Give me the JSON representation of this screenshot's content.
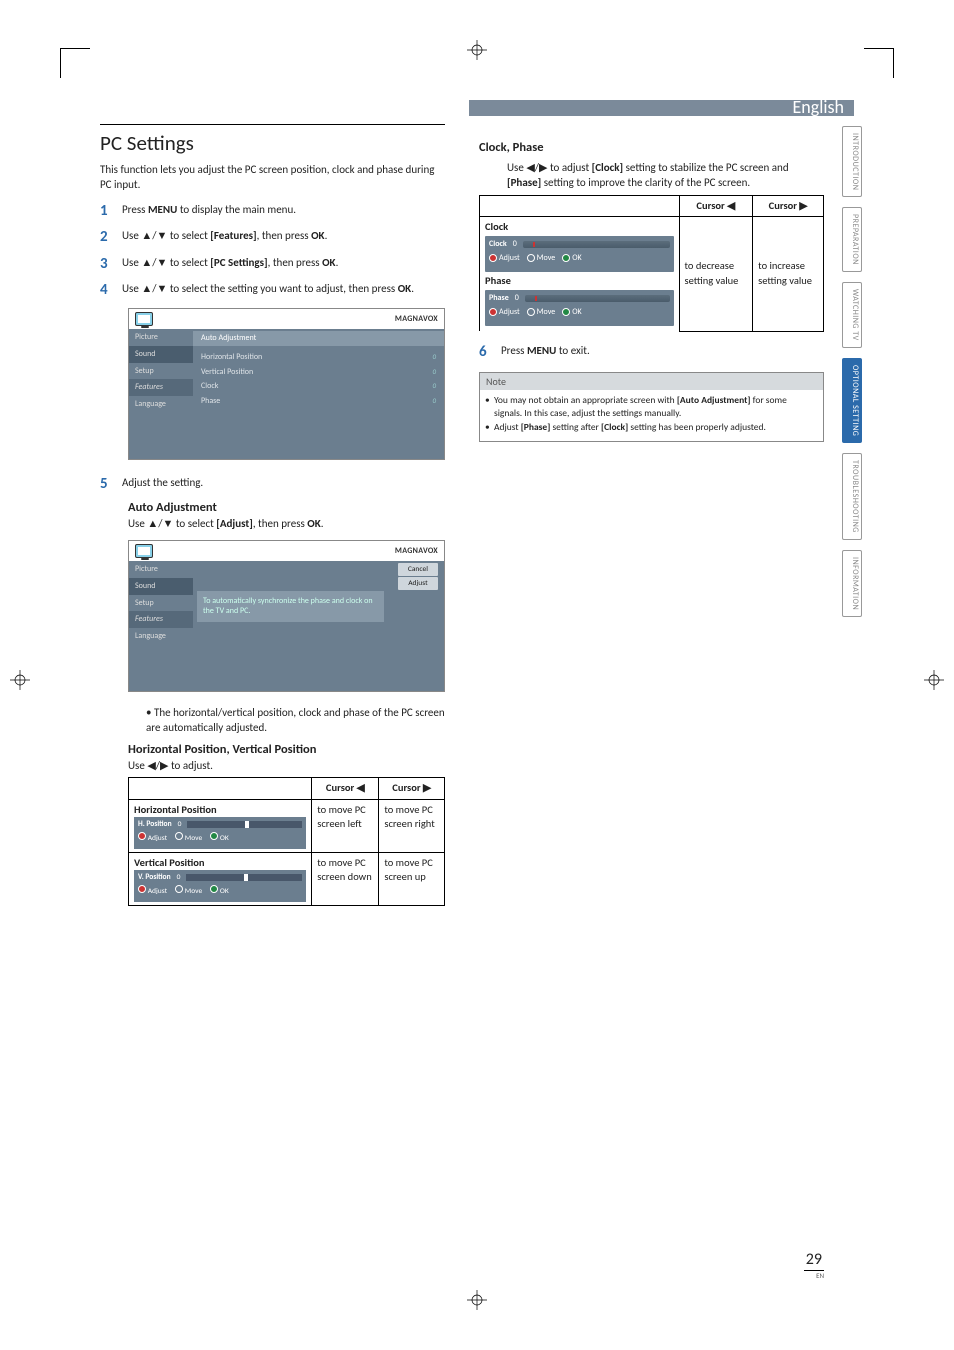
{
  "header": {
    "lang": "English"
  },
  "sidebar": [
    "INTRODUCTION",
    "PREPARATION",
    "WATCHING TV",
    "OPTIONAL SETTING",
    "TROUBLESHOOTING",
    "INFORMATION"
  ],
  "left": {
    "h1": "PC Settings",
    "intro": "This function lets you adjust the PC screen position, clock and phase during PC input.",
    "steps": [
      {
        "n": "1",
        "pre": "Press ",
        "b": "MENU",
        "post": " to display the main menu."
      },
      {
        "n": "2",
        "pre": "Use ▲/▼ to select ",
        "b": "[Features]",
        "mid": ", then press ",
        "b2": "OK",
        "post": "."
      },
      {
        "n": "3",
        "pre": "Use ▲/▼ to select ",
        "b": "[PC Settings]",
        "mid": ", then press ",
        "b2": "OK",
        "post": "."
      },
      {
        "n": "4",
        "pre": "Use ▲/▼ to select the setting you want to adjust, then press ",
        "b": "OK",
        "post": "."
      }
    ],
    "osd1": {
      "logo": "MAGNAVOX",
      "left": [
        "Picture",
        "Sound",
        "Setup",
        "Features",
        "Language"
      ],
      "rows": [
        {
          "l": "Auto Adjustment",
          "v": ""
        },
        {
          "l": "",
          "v": ""
        },
        {
          "l": "Horizontal Position",
          "v": "0"
        },
        {
          "l": "Vertical Position",
          "v": "0"
        },
        {
          "l": "Clock",
          "v": "0"
        },
        {
          "l": "Phase",
          "v": "0"
        }
      ]
    },
    "step5": {
      "n": "5",
      "t": "Adjust the setting."
    },
    "auto": {
      "h": "Auto Adjustment",
      "sub_pre": "Use ▲/▼ to select ",
      "sub_b": "[Adjust]",
      "sub_mid": ", then press ",
      "sub_b2": "OK",
      "sub_post": ".",
      "osd_logo": "MAGNAVOX",
      "osd_left": [
        "Picture",
        "Sound",
        "Setup",
        "Features",
        "Language"
      ],
      "osd_info": "To automatically synchronize the phase and clock on the TV and PC.",
      "btn_cancel": "Cancel",
      "btn_adjust": "Adjust",
      "bullet": "The horizontal/vertical position, clock and phase of the PC screen are automatically adjusted."
    },
    "hp": {
      "h": "Horizontal Position, Vertical Position",
      "sub": "Use ◀/▶ to adjust.",
      "th_l": "Cursor ◀",
      "th_r": "Cursor ▶",
      "r1": {
        "h": "Horizontal Position",
        "panel": "H. Position",
        "v": "0",
        "adjust": "Adjust",
        "move": "Move",
        "ok": "OK",
        "l": "to move PC screen left",
        "r": "to move PC screen right"
      },
      "r2": {
        "h": "Vertical Position",
        "panel": "V. Position",
        "v": "0",
        "adjust": "Adjust",
        "move": "Move",
        "ok": "OK",
        "l": "to move PC screen down",
        "r": "to move PC screen up"
      }
    }
  },
  "right": {
    "h": "Clock, Phase",
    "sub_pre": "Use ◀/▶ to adjust ",
    "sub_b1": "[Clock]",
    "sub_mid1": " setting to stabilize the PC screen and ",
    "sub_b2": "[Phase]",
    "sub_mid2": " setting to improve the clarity of the PC screen.",
    "th_l": "Cursor ◀",
    "th_r": "Cursor ▶",
    "r_clock": {
      "h": "Clock",
      "panel": "Clock",
      "v": "0",
      "adjust": "Adjust",
      "move": "Move",
      "ok": "OK"
    },
    "r_phase": {
      "h": "Phase",
      "panel": "Phase",
      "v": "0",
      "adjust": "Adjust",
      "move": "Move",
      "ok": "OK"
    },
    "val_l": "to decrease setting value",
    "val_r": "to increase setting value",
    "step6": {
      "n": "6",
      "pre": "Press ",
      "b": "MENU",
      "post": " to exit."
    },
    "note": {
      "h": "Note",
      "items": [
        "You may not obtain an appropriate screen with [Auto Adjustment] for some signals. In this case, adjust the settings manually.",
        "Adjust [Phase] setting after [Clock] setting has been properly adjusted."
      ]
    }
  },
  "page": {
    "num": "29",
    "en": "EN"
  }
}
